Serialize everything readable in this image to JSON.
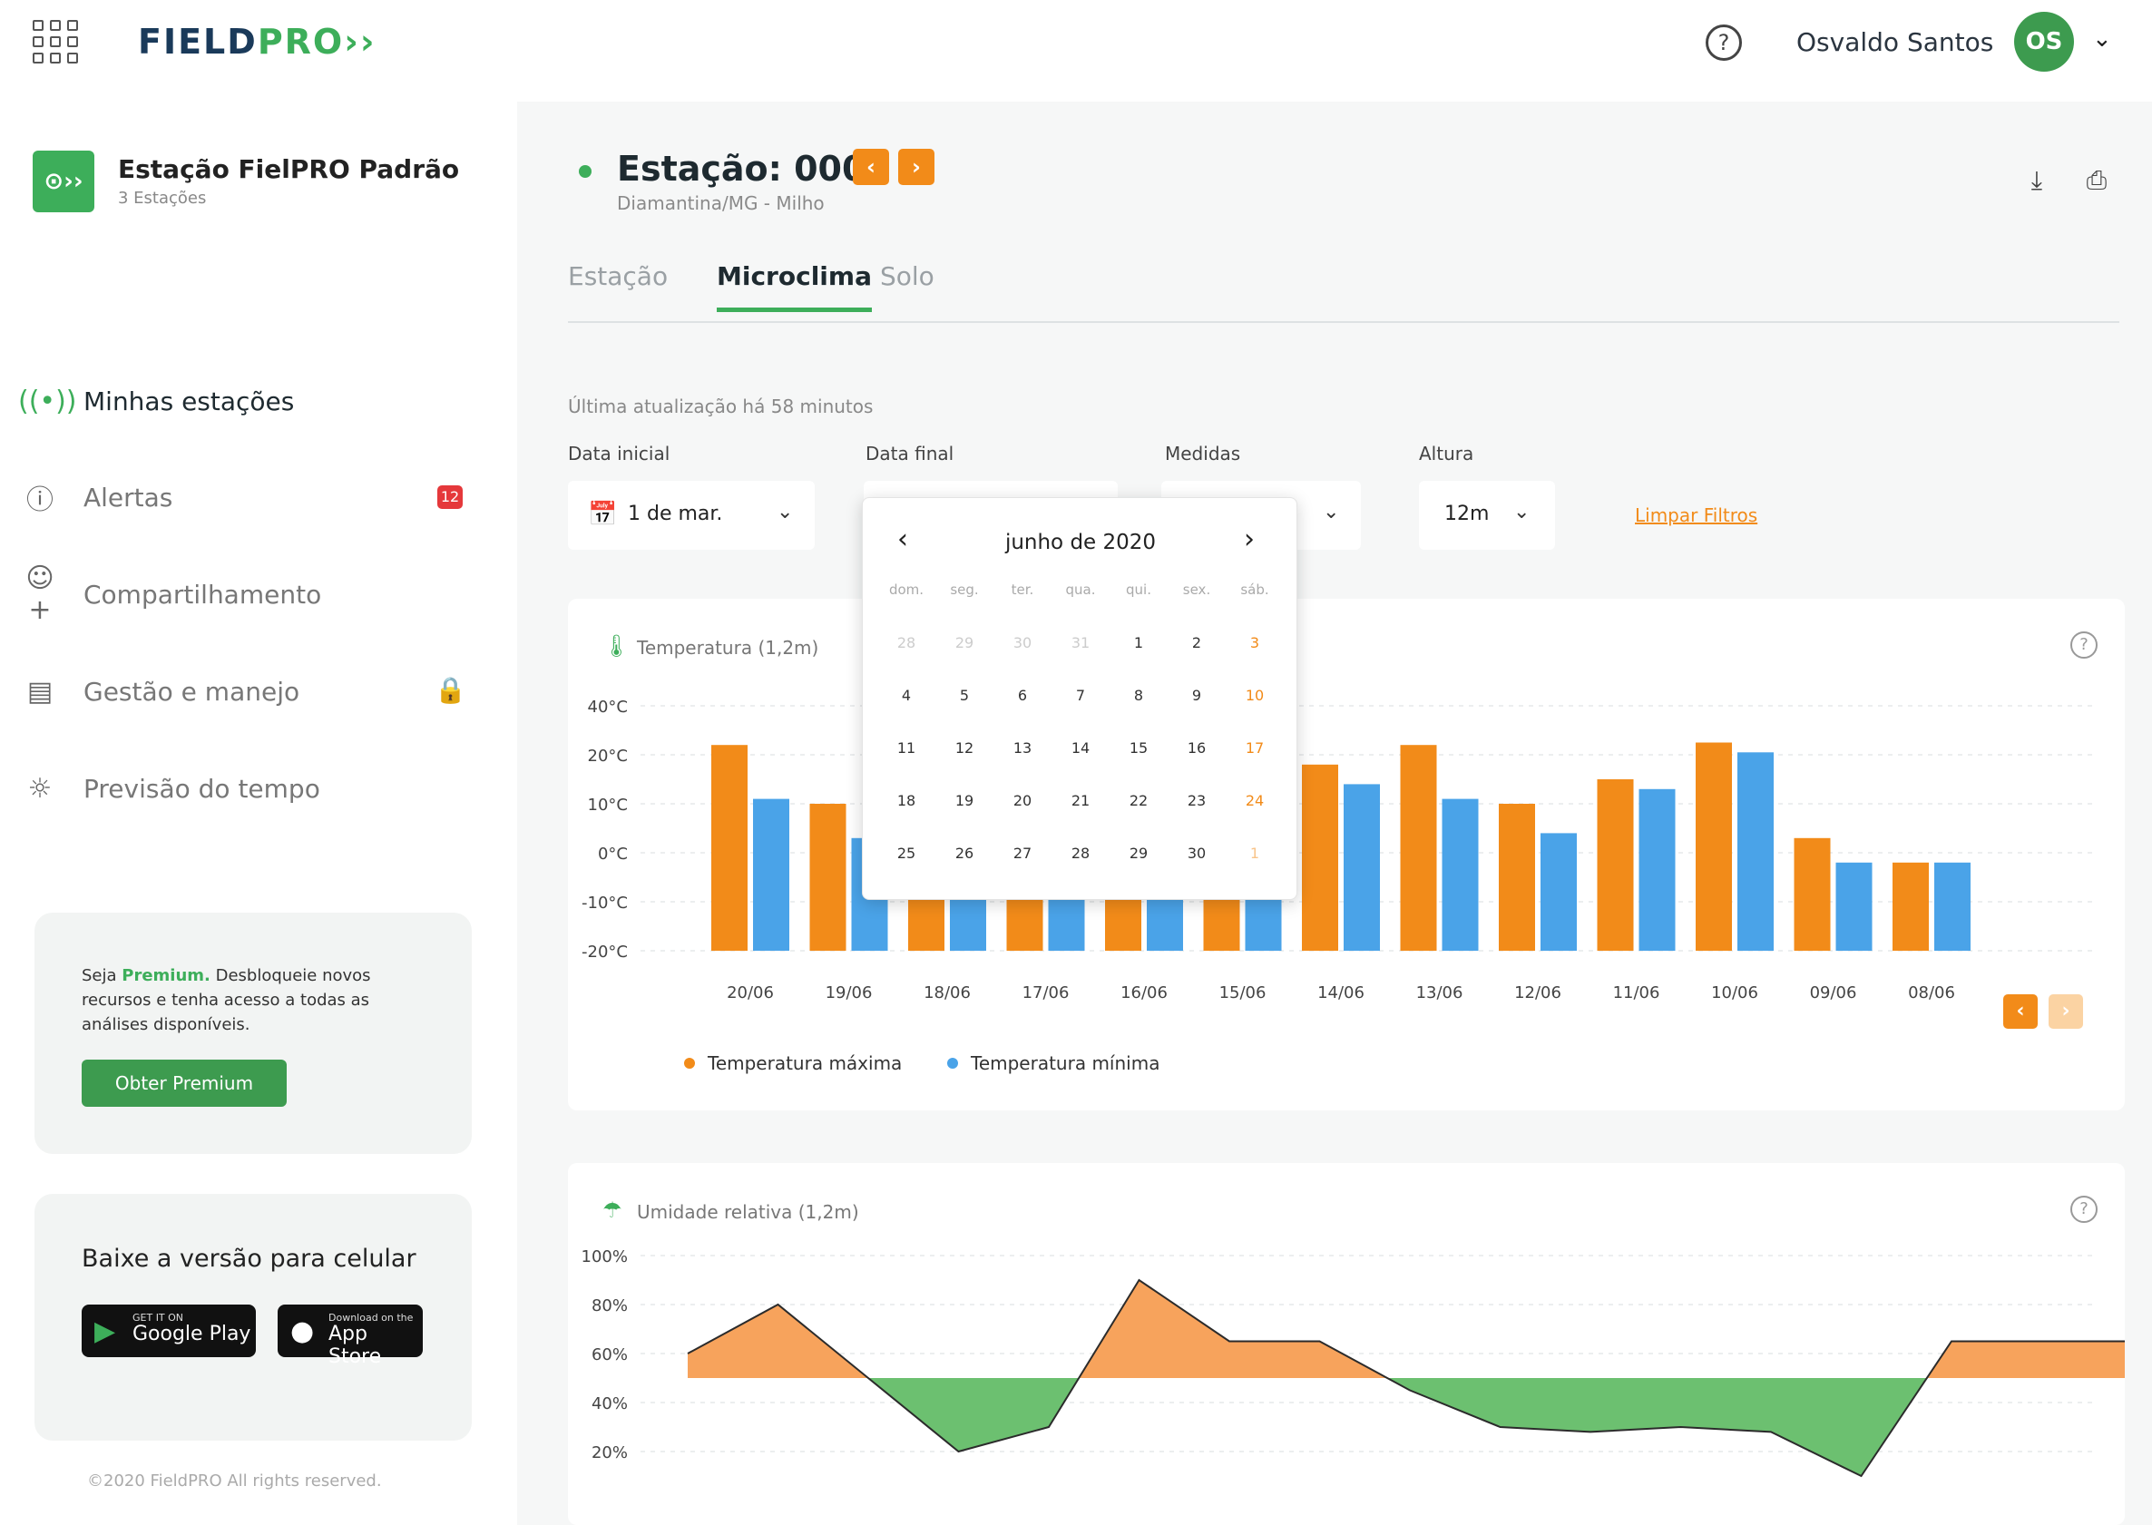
{
  "header": {
    "brand_main": "FIELD",
    "brand_accent": "PRO››",
    "user_name": "Osvaldo Santos",
    "avatar_initials": "OS"
  },
  "sidebar": {
    "station_logo": "⊙››",
    "station_name": "Estação FielPRO Padrão",
    "station_count": "3 Estações",
    "items": [
      {
        "label": "Minhas estações",
        "icon": "antenna-icon"
      },
      {
        "label": "Alertas",
        "icon": "alert-icon",
        "badge": "12"
      },
      {
        "label": "Compartilhamento",
        "icon": "share-user-icon"
      },
      {
        "label": "Gestão e manejo",
        "icon": "clipboard-icon"
      },
      {
        "label": "Previsão do tempo",
        "icon": "sun-icon"
      }
    ],
    "premium": {
      "text_prefix": "Seja ",
      "text_highlight": "Premium.",
      "text_rest": " Desbloqueie novos recursos e tenha acesso a todas as análises disponíveis.",
      "button": "Obter Premium"
    },
    "mobile": {
      "title": "Baixe a versão para celular",
      "google_small": "GET IT ON",
      "google_big": "Google Play",
      "apple_small": "Download on the",
      "apple_big": "App Store"
    },
    "copyright": "©2020 FieldPRO All rights reserved."
  },
  "main": {
    "station_title": "Estação: 0001",
    "station_subtitle": "Diamantina/MG - Milho",
    "tabs": [
      "Estação",
      "Microclima",
      "Solo"
    ],
    "active_tab": "Microclima",
    "last_update": "Última atualização há 58 minutos",
    "filters": {
      "start_label": "Data inicial",
      "start_value": "1 de mar.",
      "end_label": "Data final",
      "measures_label": "Medidas",
      "height_label": "Altura",
      "height_value": "12m",
      "clear": "Limpar Filtros"
    }
  },
  "calendar": {
    "month": "junho de 2020",
    "weekdays": [
      "dom.",
      "seg.",
      "ter.",
      "qua.",
      "qui.",
      "sex.",
      "sáb."
    ],
    "weeks": [
      [
        "28",
        "29",
        "30",
        "31",
        "1",
        "2",
        "3"
      ],
      [
        "4",
        "5",
        "6",
        "7",
        "8",
        "9",
        "10"
      ],
      [
        "11",
        "12",
        "13",
        "14",
        "15",
        "16",
        "17"
      ],
      [
        "18",
        "19",
        "20",
        "21",
        "22",
        "23",
        "24"
      ],
      [
        "25",
        "26",
        "27",
        "28",
        "29",
        "30",
        "1"
      ]
    ]
  },
  "chart_data": [
    {
      "type": "bar",
      "title": "Temperatura (1,2m)",
      "categories": [
        "20/06",
        "19/06",
        "18/06",
        "17/06",
        "16/06",
        "15/06",
        "14/06",
        "13/06",
        "12/06",
        "11/06",
        "10/06",
        "09/06",
        "08/06"
      ],
      "y_tick_labels": [
        "40°C",
        "20°C",
        "10°C",
        "0°C",
        "-10°C",
        "-20°C"
      ],
      "ylim": [
        -20,
        40
      ],
      "series": [
        {
          "name": "Temperatura máxima",
          "color": "#f28b19",
          "values": [
            24,
            10,
            8,
            16,
            14,
            18,
            18,
            24,
            10,
            15,
            25,
            3,
            -2
          ]
        },
        {
          "name": "Temperatura mínima",
          "color": "#4aa3e8",
          "values": [
            11,
            3,
            12,
            2,
            13,
            15,
            14,
            11,
            4,
            13,
            21,
            -2,
            -2
          ]
        }
      ],
      "legend_position": "bottom-left",
      "grid": true
    },
    {
      "type": "area",
      "title": "Umidade relativa (1,2m)",
      "y_tick_labels": [
        "100%",
        "80%",
        "60%",
        "40%",
        "20%"
      ],
      "ylim": [
        20,
        100
      ],
      "baseline": 50,
      "values": [
        60,
        80,
        50,
        20,
        30,
        90,
        65,
        65,
        45,
        30,
        28,
        30,
        28,
        10,
        65,
        65,
        65
      ],
      "colors": {
        "above": "#f7a35c",
        "below": "#6cc070"
      },
      "grid": true
    }
  ]
}
